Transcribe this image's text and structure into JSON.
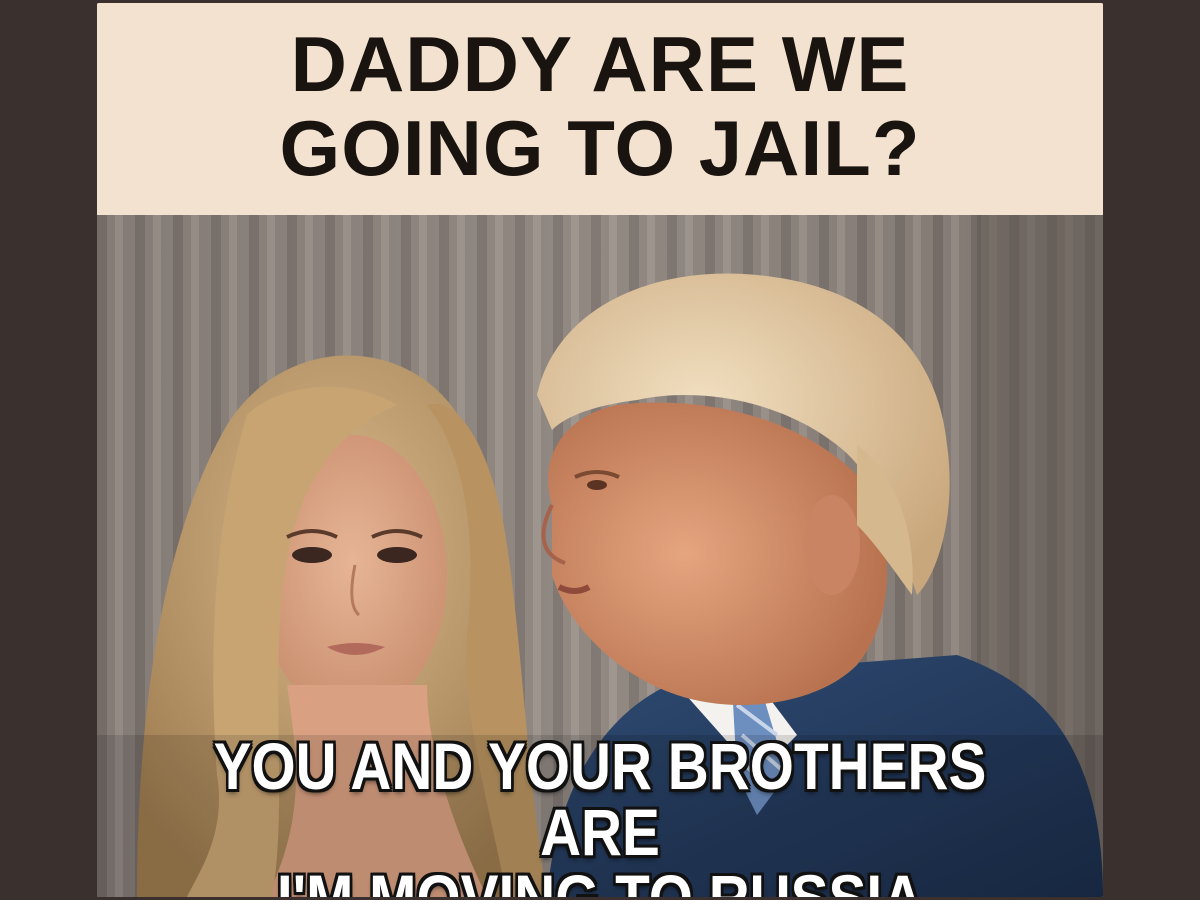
{
  "meme": {
    "top_caption": "DADDY ARE WE\nGOING TO JAIL?",
    "bottom_caption": "YOU AND YOUR BROTHERS ARE\nI'M MOVING TO RUSSIA"
  },
  "colors": {
    "page_background": "#3a312f",
    "caption_band": "#f3e2cf",
    "caption_text": "#1a1411",
    "overlay_text": "#ffffff"
  }
}
